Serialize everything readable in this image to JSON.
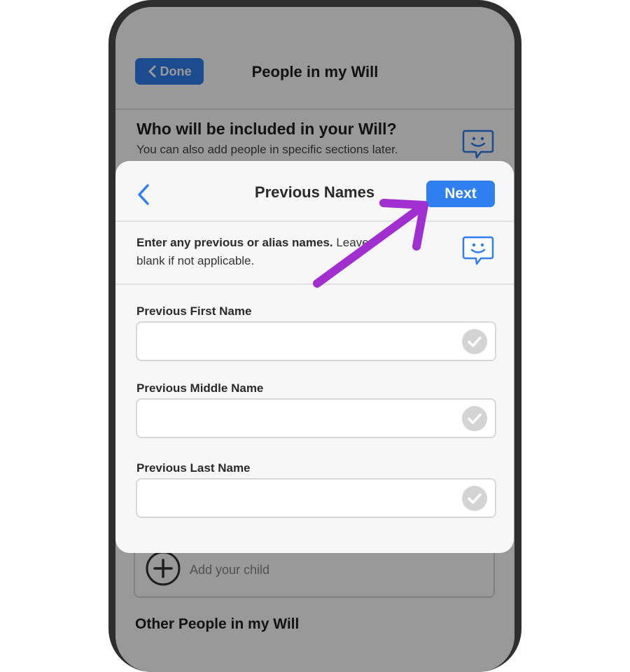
{
  "background": {
    "done_label": "Done",
    "title": "People in my Will",
    "question": "Who will be included in your Will?",
    "subtitle": "You can also add people in specific sections later.",
    "add_child_label": "Add your child",
    "other_people_heading": "Other People in my Will"
  },
  "modal": {
    "title": "Previous Names",
    "next_label": "Next",
    "instructions_bold": "Enter any previous or alias names.",
    "instructions_rest": " Leave blank if not applicable.",
    "fields": [
      {
        "label": "Previous First Name",
        "value": "",
        "placeholder": ""
      },
      {
        "label": "Previous Middle Name",
        "value": "",
        "placeholder": ""
      },
      {
        "label": "Previous Last Name",
        "value": "",
        "placeholder": ""
      }
    ]
  },
  "colors": {
    "accent": "#2f7ff0",
    "annotation_arrow": "#a12fcf"
  },
  "icons": {
    "back": "chevron-left-icon",
    "help": "chat-smiley-help-icon",
    "field_status": "check-circle-icon",
    "add": "plus-circle-icon",
    "annotation": "arrow-icon"
  }
}
